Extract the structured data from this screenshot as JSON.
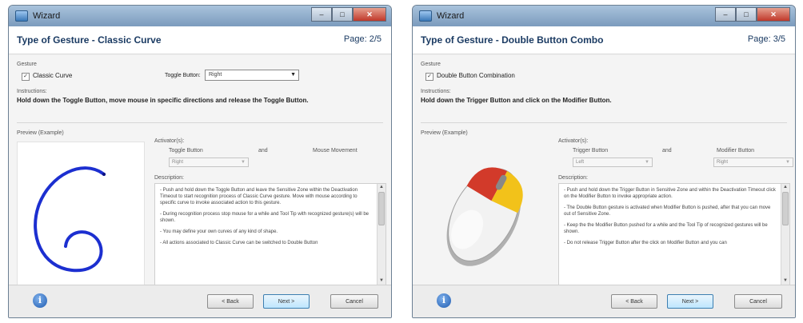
{
  "windows": [
    {
      "window_title": "Wizard",
      "header_title": "Type of Gesture - Classic Curve",
      "page": "Page: 2/5",
      "gesture_label": "Gesture",
      "checkbox_label": "Classic Curve",
      "checked": true,
      "toggle_label": "Toggle Button:",
      "toggle_value": "Right",
      "instructions_label": "Instructions:",
      "instructions_text": "Hold down the Toggle Button, move mouse in specific directions and release the Toggle Button.",
      "preview_label": "Preview (Example)",
      "activation_label": "Activator(s):",
      "col_a_label": "Toggle Button",
      "and_label": "and",
      "col_b_label": "Mouse Movement",
      "col_a_value": "Right",
      "col_b_value": "",
      "description_label": "Description:",
      "description": [
        "- Push and hold down the Toggle Button and leave the Sensitive Zone within the Deactivation Timeout to start recognition process of Classic Curve gesture. Move with mouse according to specific curve to invoke associated action to this gesture.",
        "- During recognition process stop mouse for a while and Tool Tip with recognized gesture(s) will be shown.",
        "- You may define your own curves of any kind of shape.",
        "- All actions associated to Classic Curve can be switched to Double Button"
      ],
      "buttons": {
        "back": "< Back",
        "next": "Next >",
        "cancel": "Cancel"
      }
    },
    {
      "window_title": "Wizard",
      "header_title": "Type of Gesture - Double Button Combo",
      "page": "Page: 3/5",
      "gesture_label": "Gesture",
      "checkbox_label": "Double Button Combination",
      "checked": true,
      "instructions_label": "Instructions:",
      "instructions_text": "Hold down the Trigger Button and click on the Modifier Button.",
      "preview_label": "Preview (Example)",
      "activation_label": "Activator(s):",
      "col_a_label": "Trigger Button",
      "and_label": "and",
      "col_b_label": "Modifier Button",
      "col_a_value": "Left",
      "col_b_value": "Right",
      "description_label": "Description:",
      "description": [
        "- Push and hold down the Trigger Button in Sensitive Zone and within the Deactivation Timeout click on the Modifier Button to invoke appropriate action.",
        "- The Double Button gesture is activated when Modifier Button is pushed, after that you can move out of Sensitive Zone.",
        "- Keep the the Modifier Button pushed for a while and the Tool Tip of recognized gestures will be shown.",
        "- Do not release Trigger Button after the click on Modifier Button and you can"
      ],
      "buttons": {
        "back": "< Back",
        "next": "Next >",
        "cancel": "Cancel"
      }
    }
  ],
  "colors": {
    "curve": "#1c2fd0",
    "mouse_red": "#d23a2a",
    "mouse_yellow": "#f2c21a",
    "accent": "#1b3b63"
  }
}
